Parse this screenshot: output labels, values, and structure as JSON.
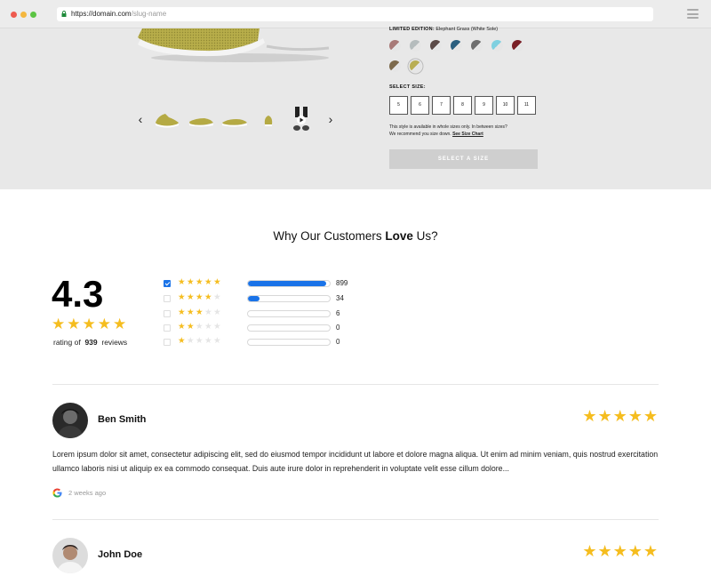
{
  "browser": {
    "url_host": "https://domain.com",
    "url_path": "/slug-name"
  },
  "product": {
    "limited_label": "LIMITED EDITION:",
    "limited_value": "Elephant Grass (White Sole)",
    "swatch_colors": [
      "#a87a78",
      "#b5bcbd",
      "#5b4a47",
      "#2b5f7f",
      "#6e6e6e",
      "#7fd0e0",
      "#7a1f26",
      "#7d6a4c",
      "#b9ae52"
    ],
    "size_label": "SELECT SIZE:",
    "sizes": [
      "5",
      "6",
      "7",
      "8",
      "9",
      "10",
      "11"
    ],
    "size_note_line1": "This style is available in whole sizes only. In between sizes?",
    "size_note_line2": "We recommend you size down.",
    "size_chart_link": "See Size Chart",
    "select_button": "SELECT A SIZE",
    "thumb_prev": "‹",
    "thumb_next": "›"
  },
  "reviews": {
    "title_prefix": "Why Our Customers",
    "title_bold": "Love",
    "title_suffix": "Us?",
    "average": "4.3",
    "average_stars": "★★★★★",
    "rating_of": "rating of",
    "total": "939",
    "reviews_word": "reviews",
    "distribution": [
      {
        "stars": 5,
        "count": "899",
        "fraction": 0.96,
        "checked": true
      },
      {
        "stars": 4,
        "count": "34",
        "fraction": 0.14,
        "checked": false
      },
      {
        "stars": 3,
        "count": "6",
        "fraction": 0,
        "checked": false
      },
      {
        "stars": 2,
        "count": "0",
        "fraction": 0,
        "checked": false
      },
      {
        "stars": 1,
        "count": "0",
        "fraction": 0,
        "checked": false
      }
    ],
    "items": [
      {
        "name": "Ben Smith",
        "stars": "★★★★★",
        "text": "Lorem ipsum dolor sit amet, consectetur adipiscing elit, sed do eiusmod tempor incididunt ut labore et dolore magna aliqua. Ut enim ad minim veniam, quis nostrud exercitation ullamco laboris nisi ut aliquip ex ea commodo consequat. Duis aute irure dolor in reprehenderit in voluptate velit esse cillum dolore...",
        "time": "2 weeks ago"
      },
      {
        "name": "John Doe",
        "stars": "★★★★★"
      }
    ]
  }
}
